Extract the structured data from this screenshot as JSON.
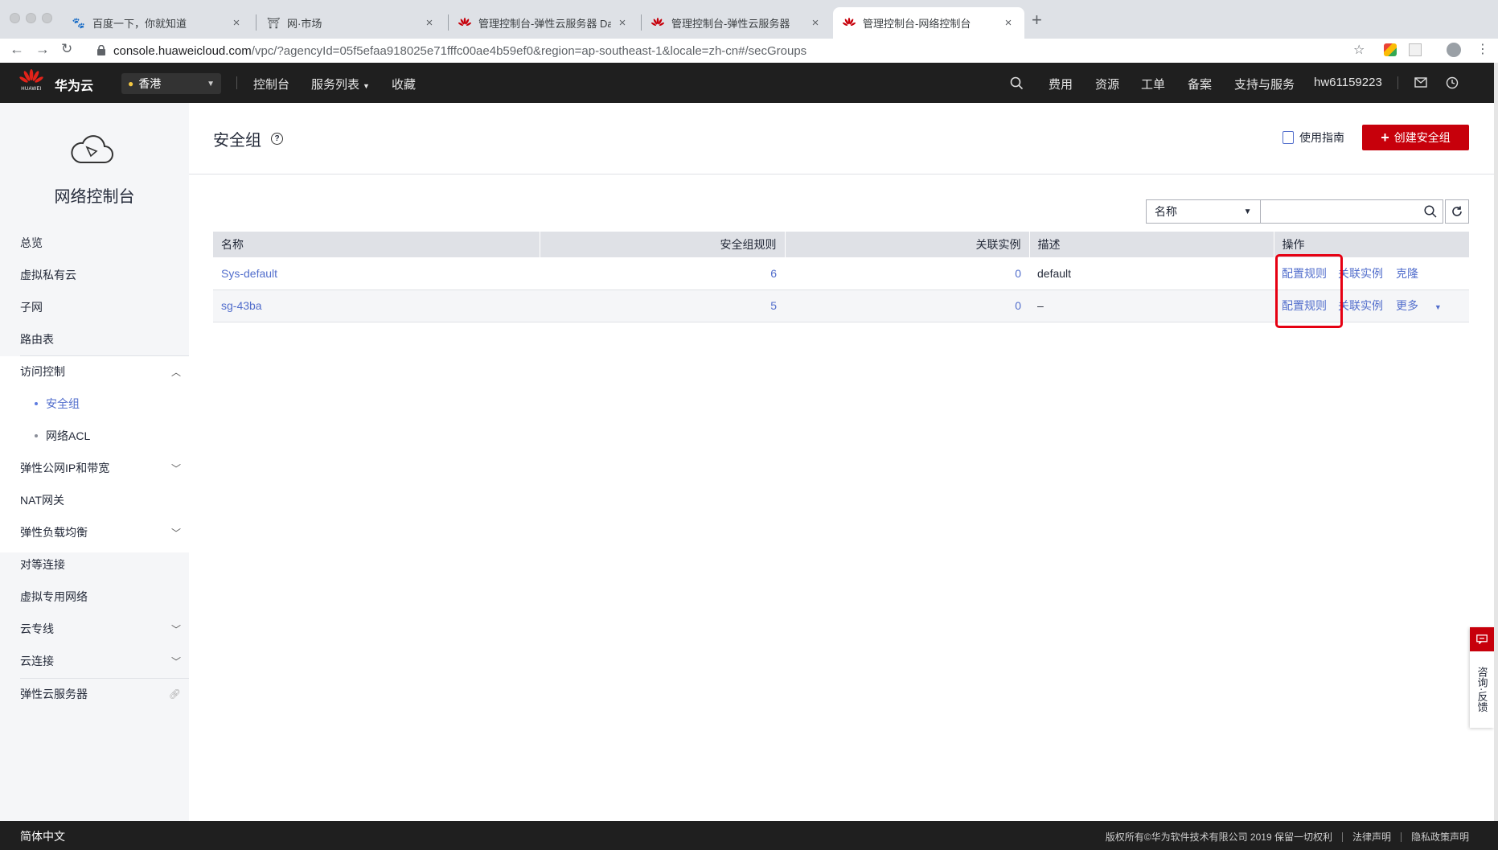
{
  "browser": {
    "tabs": [
      {
        "title": "百度一下，你就知道",
        "icon": "baidu-paw-icon",
        "active": false
      },
      {
        "title": "网·市场",
        "icon": "market-icon",
        "active": false
      },
      {
        "title": "管理控制台-弹性云服务器 Dash",
        "icon": "huawei-logo-icon",
        "active": false
      },
      {
        "title": "管理控制台-弹性云服务器",
        "icon": "huawei-logo-icon",
        "active": false
      },
      {
        "title": "管理控制台-网络控制台",
        "icon": "huawei-logo-icon",
        "active": true
      }
    ],
    "new_tab": "+",
    "close": "×",
    "url_host": "console.huaweicloud.com",
    "url_path": "/vpc/?agencyId=05f5efaa918025e71fffc00ae4b59ef0&region=ap-southeast-1&locale=zh-cn#/secGroups"
  },
  "header": {
    "logo_text": "HUAWEI",
    "brand": "华为云",
    "region": "香港",
    "nav": [
      "控制台",
      "服务列表",
      "收藏"
    ],
    "right_nav": [
      "费用",
      "资源",
      "工单",
      "备案",
      "支持与服务",
      "hw61159223"
    ],
    "brand_color": "#c7000b"
  },
  "sidebar": {
    "title": "网络控制台",
    "items": [
      {
        "label": "总览"
      },
      {
        "label": "虚拟私有云"
      },
      {
        "label": "子网"
      },
      {
        "label": "路由表"
      },
      {
        "label": "访问控制"
      },
      {
        "label": "安全组"
      },
      {
        "label": "网络ACL"
      },
      {
        "label": "弹性公网IP和带宽"
      },
      {
        "label": "NAT网关"
      },
      {
        "label": "弹性负载均衡"
      },
      {
        "label": "对等连接"
      },
      {
        "label": "虚拟专用网络"
      },
      {
        "label": "云专线"
      },
      {
        "label": "云连接"
      },
      {
        "label": "弹性云服务器"
      }
    ]
  },
  "main": {
    "title": "安全组",
    "help": "?",
    "guide": "使用指南",
    "create_button": "创建安全组",
    "filter": {
      "field": "名称",
      "placeholder": ""
    },
    "table": {
      "columns": [
        "名称",
        "安全组规则",
        "关联实例",
        "描述",
        "操作"
      ],
      "rows": [
        {
          "name": "Sys-default",
          "rules": "6",
          "instances": "0",
          "desc": "default",
          "op1": "配置规则",
          "op2": "关联实例",
          "op3": "克隆"
        },
        {
          "name": "sg-43ba",
          "rules": "5",
          "instances": "0",
          "desc": "–",
          "op1": "配置规则",
          "op2": "关联实例",
          "op3": "更多"
        }
      ]
    },
    "link_color": "#526ecc",
    "highlight_color": "#e60012"
  },
  "footer": {
    "lang": "简体中文",
    "copyright": "版权所有©华为软件技术有限公司 2019 保留一切权利",
    "legal": "法律声明",
    "privacy": "隐私政策声明"
  },
  "feedback": {
    "label": "咨询·反馈"
  }
}
